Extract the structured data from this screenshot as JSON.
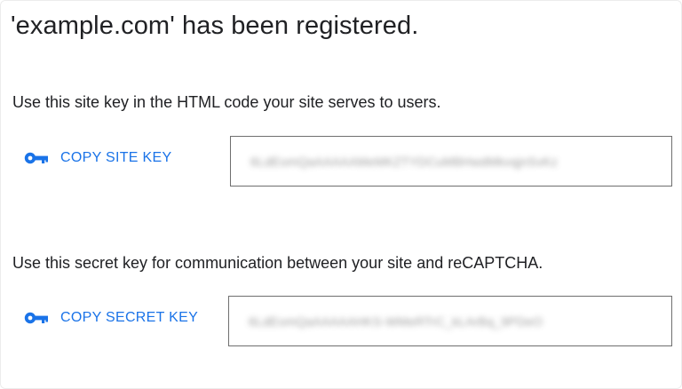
{
  "title": "'example.com' has been registered.",
  "site_key": {
    "instruction": "Use this site key in the HTML code your site serves to users.",
    "copy_label": "COPY SITE KEY",
    "icon": "key-icon",
    "value": "6LdEomQaAAAAAMeMKZTYDCuMBHwdMkvqjnSvKz"
  },
  "secret_key": {
    "instruction": "Use this secret key for communication between your site and reCAPTCHA.",
    "copy_label": "COPY SECRET KEY",
    "icon": "key-icon",
    "value": "6LdEomQaAAAAAHKS-WMeRTrC_kLArBq_9PDeO"
  },
  "colors": {
    "accent": "#1a73e8",
    "text": "#202124",
    "field_border": "#6f6f6f"
  }
}
